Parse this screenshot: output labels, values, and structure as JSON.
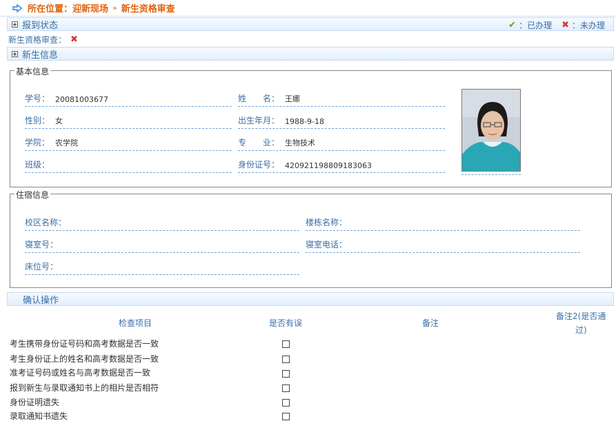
{
  "breadcrumb": {
    "label": "所在位置：迎新现场",
    "current": "新生资格审查"
  },
  "report_status": {
    "title": "报到状态",
    "done_label": "：已办理",
    "undone_label": "：未办理",
    "review_label": "新生资格审查："
  },
  "student_info": {
    "title": "新生信息",
    "basic": {
      "legend": "基本信息",
      "student_id_label": "学号：",
      "student_id": "20081003677",
      "name_label": "姓　　名：",
      "name": "王娜",
      "gender_label": "性别：",
      "gender": "女",
      "birth_label": "出生年月：",
      "birth": "1988-9-18",
      "college_label": "学院：",
      "college": "农学院",
      "major_label": "专　　业：",
      "major": "生物技术",
      "class_label": "班级：",
      "class": "",
      "idcard_label": "身份证号：",
      "idcard": "420921198809183063"
    },
    "dorm": {
      "legend": "住宿信息",
      "campus_label": "校区名称：",
      "campus": "",
      "building_label": "楼栋名称：",
      "building": "",
      "room_label": "寝室号：",
      "room": "",
      "phone_label": "寝室电话：",
      "phone": "",
      "bed_label": "床位号：",
      "bed": ""
    }
  },
  "confirm": {
    "title": "确认操作",
    "headers": {
      "item": "检查项目",
      "error": "是否有误",
      "note": "备注",
      "note2_a": "备注2(是否通",
      "note2_b": "过)"
    },
    "rows": [
      {
        "item": "考生携带身份证号码和高考数据是否一致"
      },
      {
        "item": "考生身份证上的姓名和高考数据是否一致"
      },
      {
        "item": "准考证号码或姓名与高考数据是否一致"
      },
      {
        "item": "报到新生与录取通知书上的相片是否相符"
      },
      {
        "item": "身份证明遗失"
      },
      {
        "item": "录取通知书遗失"
      }
    ]
  },
  "colors": {
    "accent": "#3a6ea5",
    "breadcrumb": "#e2620a",
    "ok": "#5aa52a",
    "fail": "#d9363e"
  }
}
